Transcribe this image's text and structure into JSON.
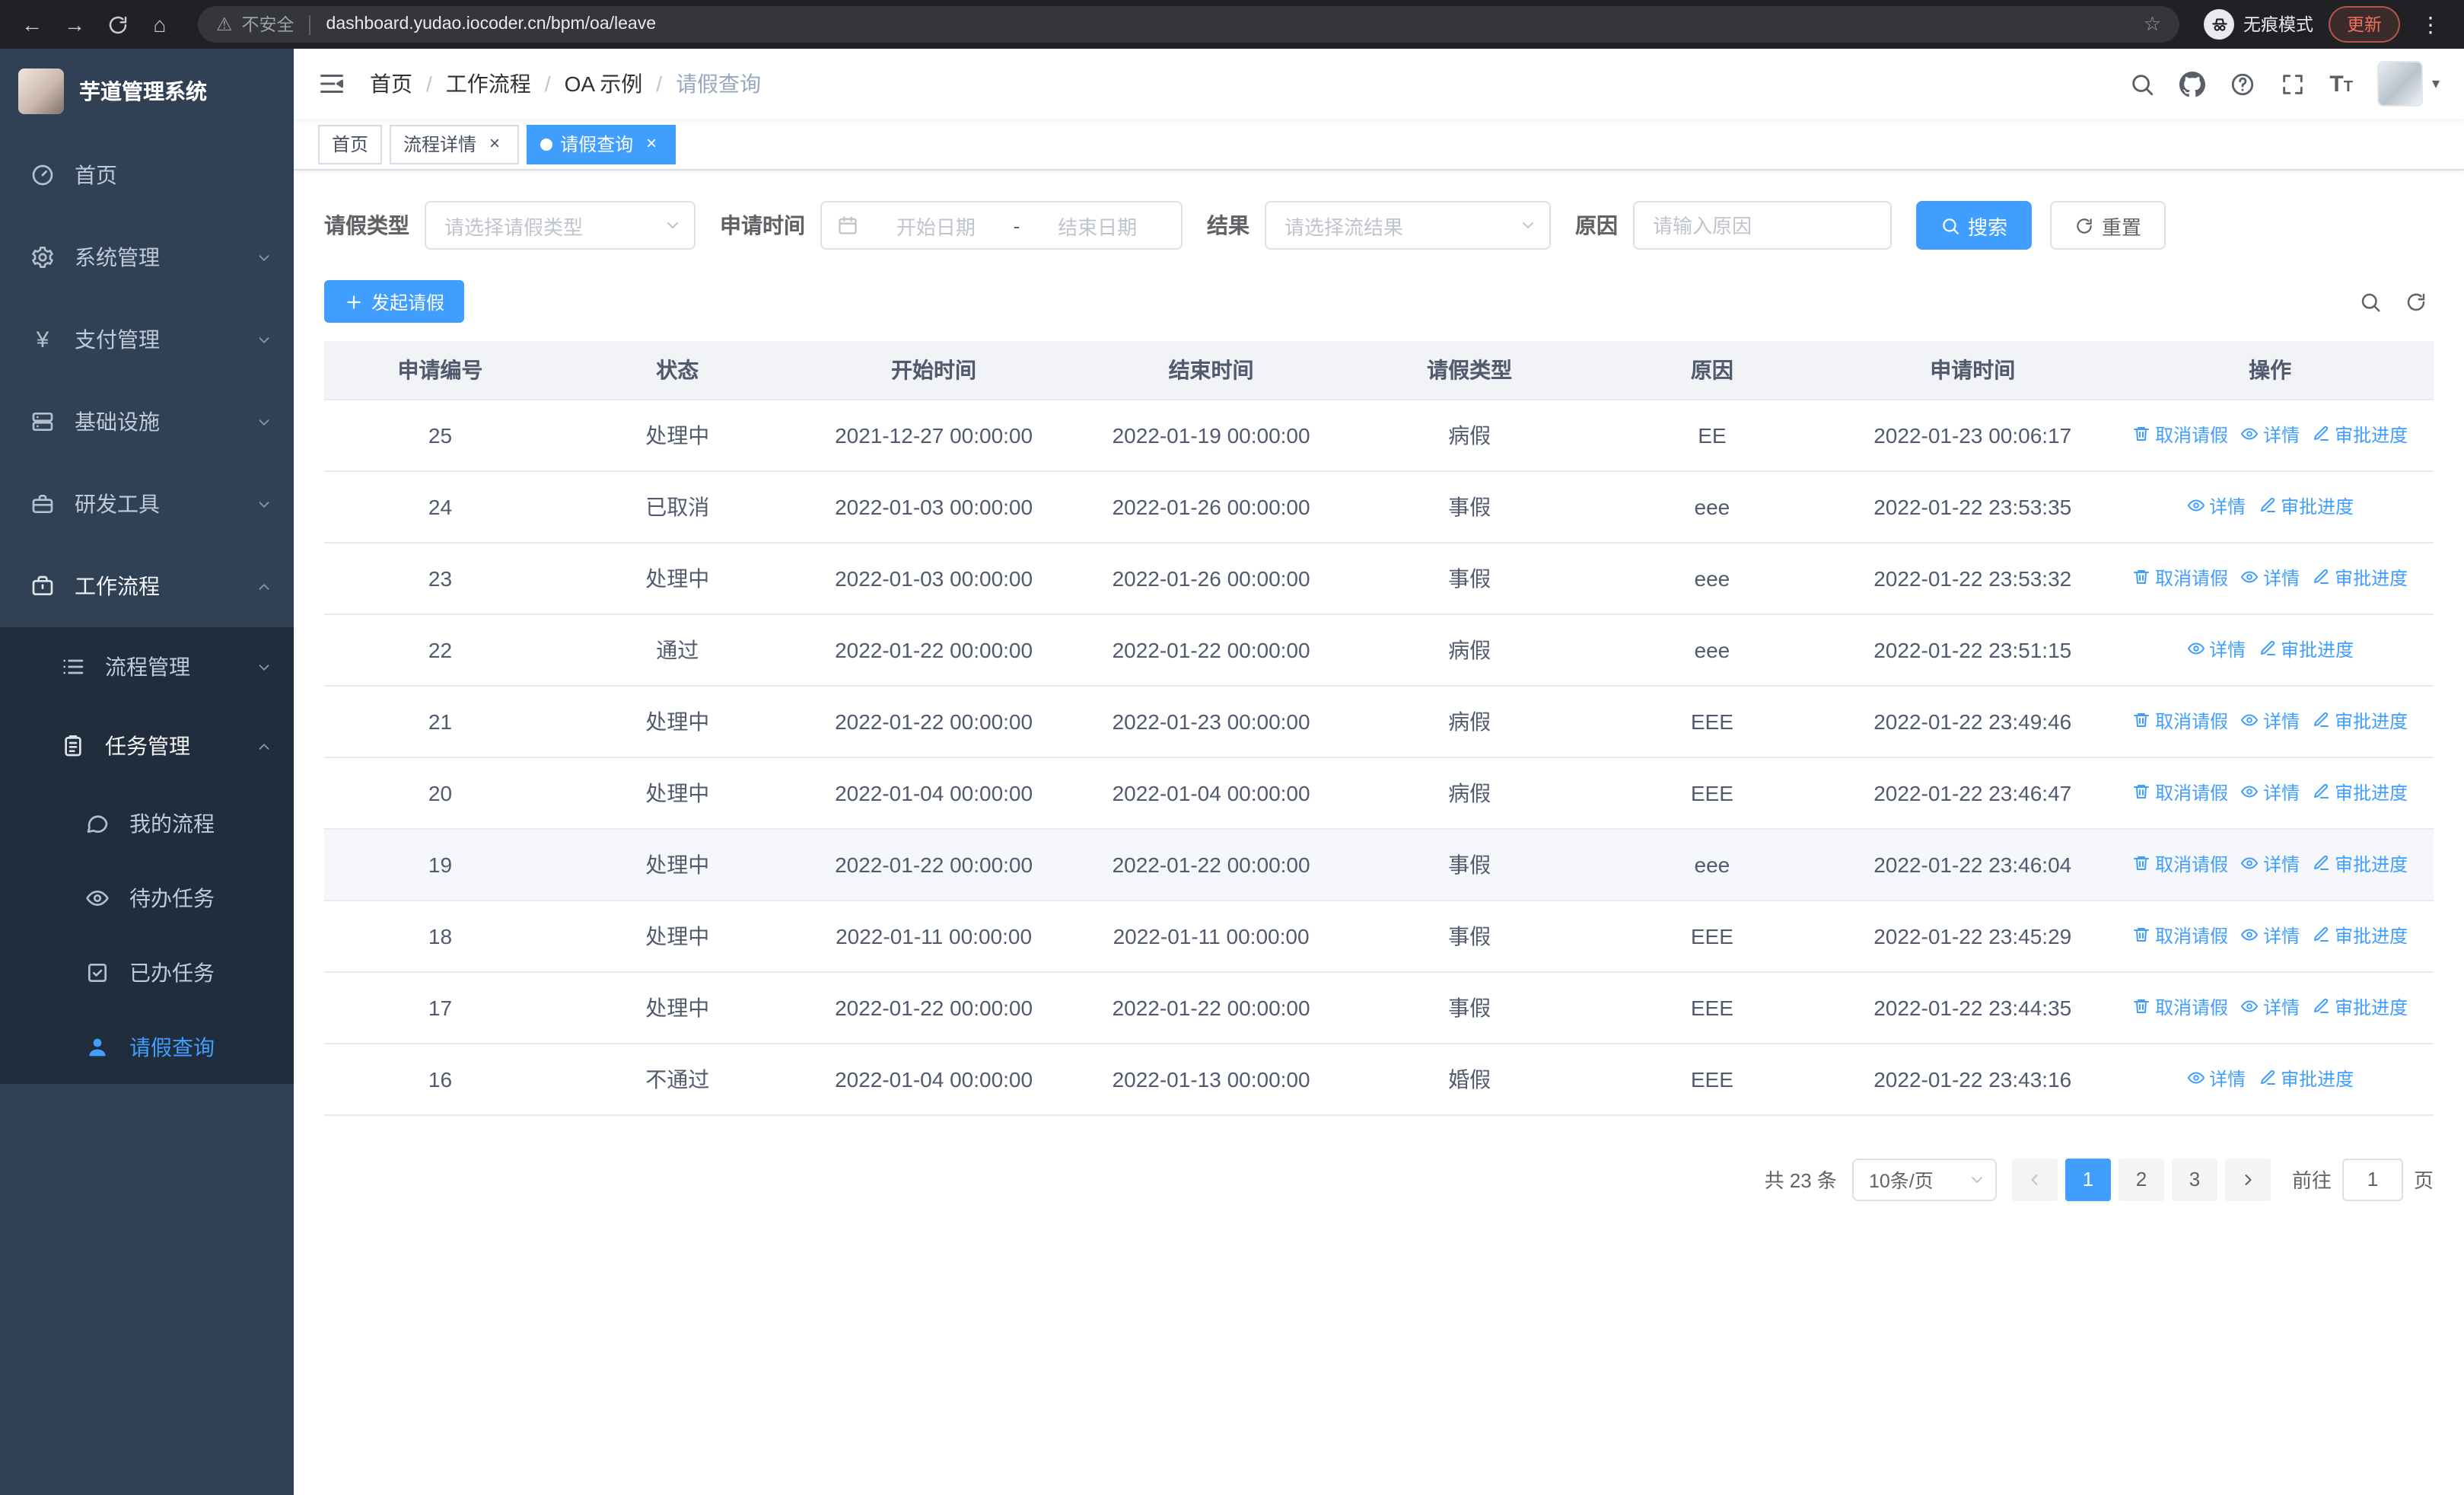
{
  "colors": {
    "accent": "#409eff",
    "sidebar_bg": "#304156",
    "submenu_bg": "#1f2d3d",
    "chrome_bg": "#202124",
    "table_header_bg": "#f1f3f6"
  },
  "chrome": {
    "security_label": "不安全",
    "url": "dashboard.yudao.iocoder.cn/bpm/oa/leave",
    "incognito_label": "无痕模式",
    "update_label": "更新"
  },
  "sidebar": {
    "title": "芋道管理系统",
    "items": [
      {
        "id": "home",
        "label": "首页",
        "icon": "dashboard-icon",
        "depth": 0
      },
      {
        "id": "system-management",
        "label": "系统管理",
        "icon": "gear-icon",
        "depth": 0,
        "chevron": "down"
      },
      {
        "id": "payment-management",
        "label": "支付管理",
        "icon": "yen-icon",
        "depth": 0,
        "chevron": "down"
      },
      {
        "id": "infrastructure",
        "label": "基础设施",
        "icon": "server-icon",
        "depth": 0,
        "chevron": "down"
      },
      {
        "id": "dev-tools",
        "label": "研发工具",
        "icon": "toolbox-icon",
        "depth": 0,
        "chevron": "down"
      },
      {
        "id": "workflow",
        "label": "工作流程",
        "icon": "workflow-icon",
        "depth": 0,
        "chevron": "up",
        "open": true
      },
      {
        "id": "process-management",
        "label": "流程管理",
        "icon": "list-icon",
        "depth": 1,
        "chevron": "down",
        "submenu": true
      },
      {
        "id": "task-management",
        "label": "任务管理",
        "icon": "clipboard-icon",
        "depth": 1,
        "chevron": "up",
        "submenu": true,
        "open": true
      },
      {
        "id": "my-process",
        "label": "我的流程",
        "icon": "chat-icon",
        "depth": 2,
        "submenu": true
      },
      {
        "id": "todo-tasks",
        "label": "待办任务",
        "icon": "eye-icon",
        "depth": 2,
        "submenu": true
      },
      {
        "id": "done-tasks",
        "label": "已办任务",
        "icon": "check-icon",
        "depth": 2,
        "submenu": true
      },
      {
        "id": "leave-query",
        "label": "请假查询",
        "icon": "user-icon",
        "depth": 2,
        "submenu": true,
        "active": true
      }
    ]
  },
  "header": {
    "breadcrumb": [
      "首页",
      "工作流程",
      "OA 示例",
      "请假查询"
    ],
    "breadcrumb_separator": "/"
  },
  "tabs": [
    {
      "id": "home",
      "label": "首页",
      "closable": false,
      "active": false
    },
    {
      "id": "process-detail",
      "label": "流程详情",
      "closable": true,
      "active": false
    },
    {
      "id": "leave-query",
      "label": "请假查询",
      "closable": true,
      "active": true
    }
  ],
  "filters": {
    "leave_type": {
      "label": "请假类型",
      "placeholder": "请选择请假类型"
    },
    "apply_time": {
      "label": "申请时间",
      "start_placeholder": "开始日期",
      "separator": "-",
      "end_placeholder": "结束日期"
    },
    "result": {
      "label": "结果",
      "placeholder": "请选择流结果"
    },
    "reason": {
      "label": "原因",
      "placeholder": "请输入原因"
    },
    "search_button": "搜索",
    "reset_button": "重置"
  },
  "toolbar": {
    "create_button": "发起请假"
  },
  "table": {
    "columns": [
      "申请编号",
      "状态",
      "开始时间",
      "结束时间",
      "请假类型",
      "原因",
      "申请时间",
      "操作"
    ],
    "action_labels": {
      "cancel": "取消请假",
      "detail": "详情",
      "progress": "审批进度"
    },
    "rows": [
      {
        "id": "25",
        "status": "处理中",
        "start": "2021-12-27 00:00:00",
        "end": "2022-01-19 00:00:00",
        "type": "病假",
        "reason": "EE",
        "apply_time": "2022-01-23 00:06:17",
        "actions": [
          "cancel",
          "detail",
          "progress"
        ]
      },
      {
        "id": "24",
        "status": "已取消",
        "start": "2022-01-03 00:00:00",
        "end": "2022-01-26 00:00:00",
        "type": "事假",
        "reason": "eee",
        "apply_time": "2022-01-22 23:53:35",
        "actions": [
          "detail",
          "progress"
        ]
      },
      {
        "id": "23",
        "status": "处理中",
        "start": "2022-01-03 00:00:00",
        "end": "2022-01-26 00:00:00",
        "type": "事假",
        "reason": "eee",
        "apply_time": "2022-01-22 23:53:32",
        "actions": [
          "cancel",
          "detail",
          "progress"
        ]
      },
      {
        "id": "22",
        "status": "通过",
        "start": "2022-01-22 00:00:00",
        "end": "2022-01-22 00:00:00",
        "type": "病假",
        "reason": "eee",
        "apply_time": "2022-01-22 23:51:15",
        "actions": [
          "detail",
          "progress"
        ]
      },
      {
        "id": "21",
        "status": "处理中",
        "start": "2022-01-22 00:00:00",
        "end": "2022-01-23 00:00:00",
        "type": "病假",
        "reason": "EEE",
        "apply_time": "2022-01-22 23:49:46",
        "actions": [
          "cancel",
          "detail",
          "progress"
        ]
      },
      {
        "id": "20",
        "status": "处理中",
        "start": "2022-01-04 00:00:00",
        "end": "2022-01-04 00:00:00",
        "type": "病假",
        "reason": "EEE",
        "apply_time": "2022-01-22 23:46:47",
        "actions": [
          "cancel",
          "detail",
          "progress"
        ]
      },
      {
        "id": "19",
        "status": "处理中",
        "start": "2022-01-22 00:00:00",
        "end": "2022-01-22 00:00:00",
        "type": "事假",
        "reason": "eee",
        "apply_time": "2022-01-22 23:46:04",
        "actions": [
          "cancel",
          "detail",
          "progress"
        ],
        "highlight": true
      },
      {
        "id": "18",
        "status": "处理中",
        "start": "2022-01-11 00:00:00",
        "end": "2022-01-11 00:00:00",
        "type": "事假",
        "reason": "EEE",
        "apply_time": "2022-01-22 23:45:29",
        "actions": [
          "cancel",
          "detail",
          "progress"
        ]
      },
      {
        "id": "17",
        "status": "处理中",
        "start": "2022-01-22 00:00:00",
        "end": "2022-01-22 00:00:00",
        "type": "事假",
        "reason": "EEE",
        "apply_time": "2022-01-22 23:44:35",
        "actions": [
          "cancel",
          "detail",
          "progress"
        ]
      },
      {
        "id": "16",
        "status": "不通过",
        "start": "2022-01-04 00:00:00",
        "end": "2022-01-13 00:00:00",
        "type": "婚假",
        "reason": "EEE",
        "apply_time": "2022-01-22 23:43:16",
        "actions": [
          "detail",
          "progress"
        ]
      }
    ]
  },
  "pagination": {
    "total": "共 23 条",
    "page_size": "10条/页",
    "pages": [
      "1",
      "2",
      "3"
    ],
    "current": "1",
    "goto_label": "前往",
    "goto_value": "1",
    "goto_unit": "页"
  }
}
